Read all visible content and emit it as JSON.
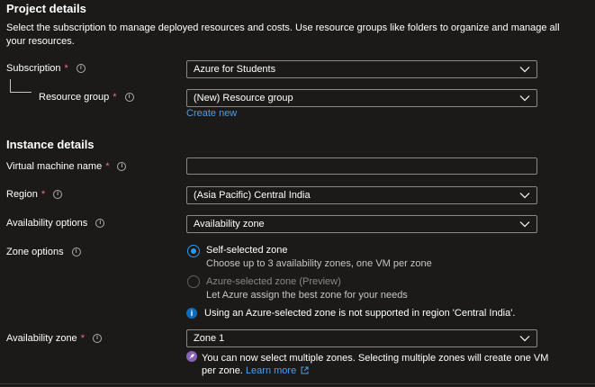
{
  "project": {
    "heading": "Project details",
    "description_line1": "Select the subscription to manage deployed resources and costs. Use resource groups like folders to organize and manage all",
    "description_line2": "your resources.",
    "subscription_label": "Subscription",
    "subscription_value": "Azure for Students",
    "resource_group_label": "Resource group",
    "resource_group_value": "(New) Resource group",
    "create_new": "Create new"
  },
  "instance": {
    "heading": "Instance details",
    "vm_name_label": "Virtual machine name",
    "vm_name_value": "",
    "region_label": "Region",
    "region_value": "(Asia Pacific) Central India",
    "availability_options_label": "Availability options",
    "availability_options_value": "Availability zone",
    "zone_options_label": "Zone options",
    "zone_option_self_title": "Self-selected zone",
    "zone_option_self_sub": "Choose up to 3 availability zones, one VM per zone",
    "zone_option_azure_title": "Azure-selected zone (Preview)",
    "zone_option_azure_sub": "Let Azure assign the best zone for your needs",
    "zone_info_note": "Using an Azure-selected zone is not supported in region 'Central India'.",
    "availability_zone_label": "Availability zone",
    "availability_zone_value": "Zone 1",
    "multi_zone_note_line1": "You can now select multiple zones. Selecting multiple zones will create one VM",
    "multi_zone_note_line2": "per zone.",
    "learn_more": "Learn more"
  },
  "required_mark": "*",
  "info_glyph": "i",
  "colors": {
    "background": "#1b1a19",
    "link": "#4f9de6",
    "required": "#f1707b",
    "radio_selected": "#2899f5",
    "info_blue": "#0f6cbd",
    "rocket_purple": "#8764b8"
  },
  "icons": {
    "info": "info-circle-icon",
    "chevron": "chevron-down-icon",
    "rocket": "rocket-icon",
    "external": "external-link-icon"
  }
}
